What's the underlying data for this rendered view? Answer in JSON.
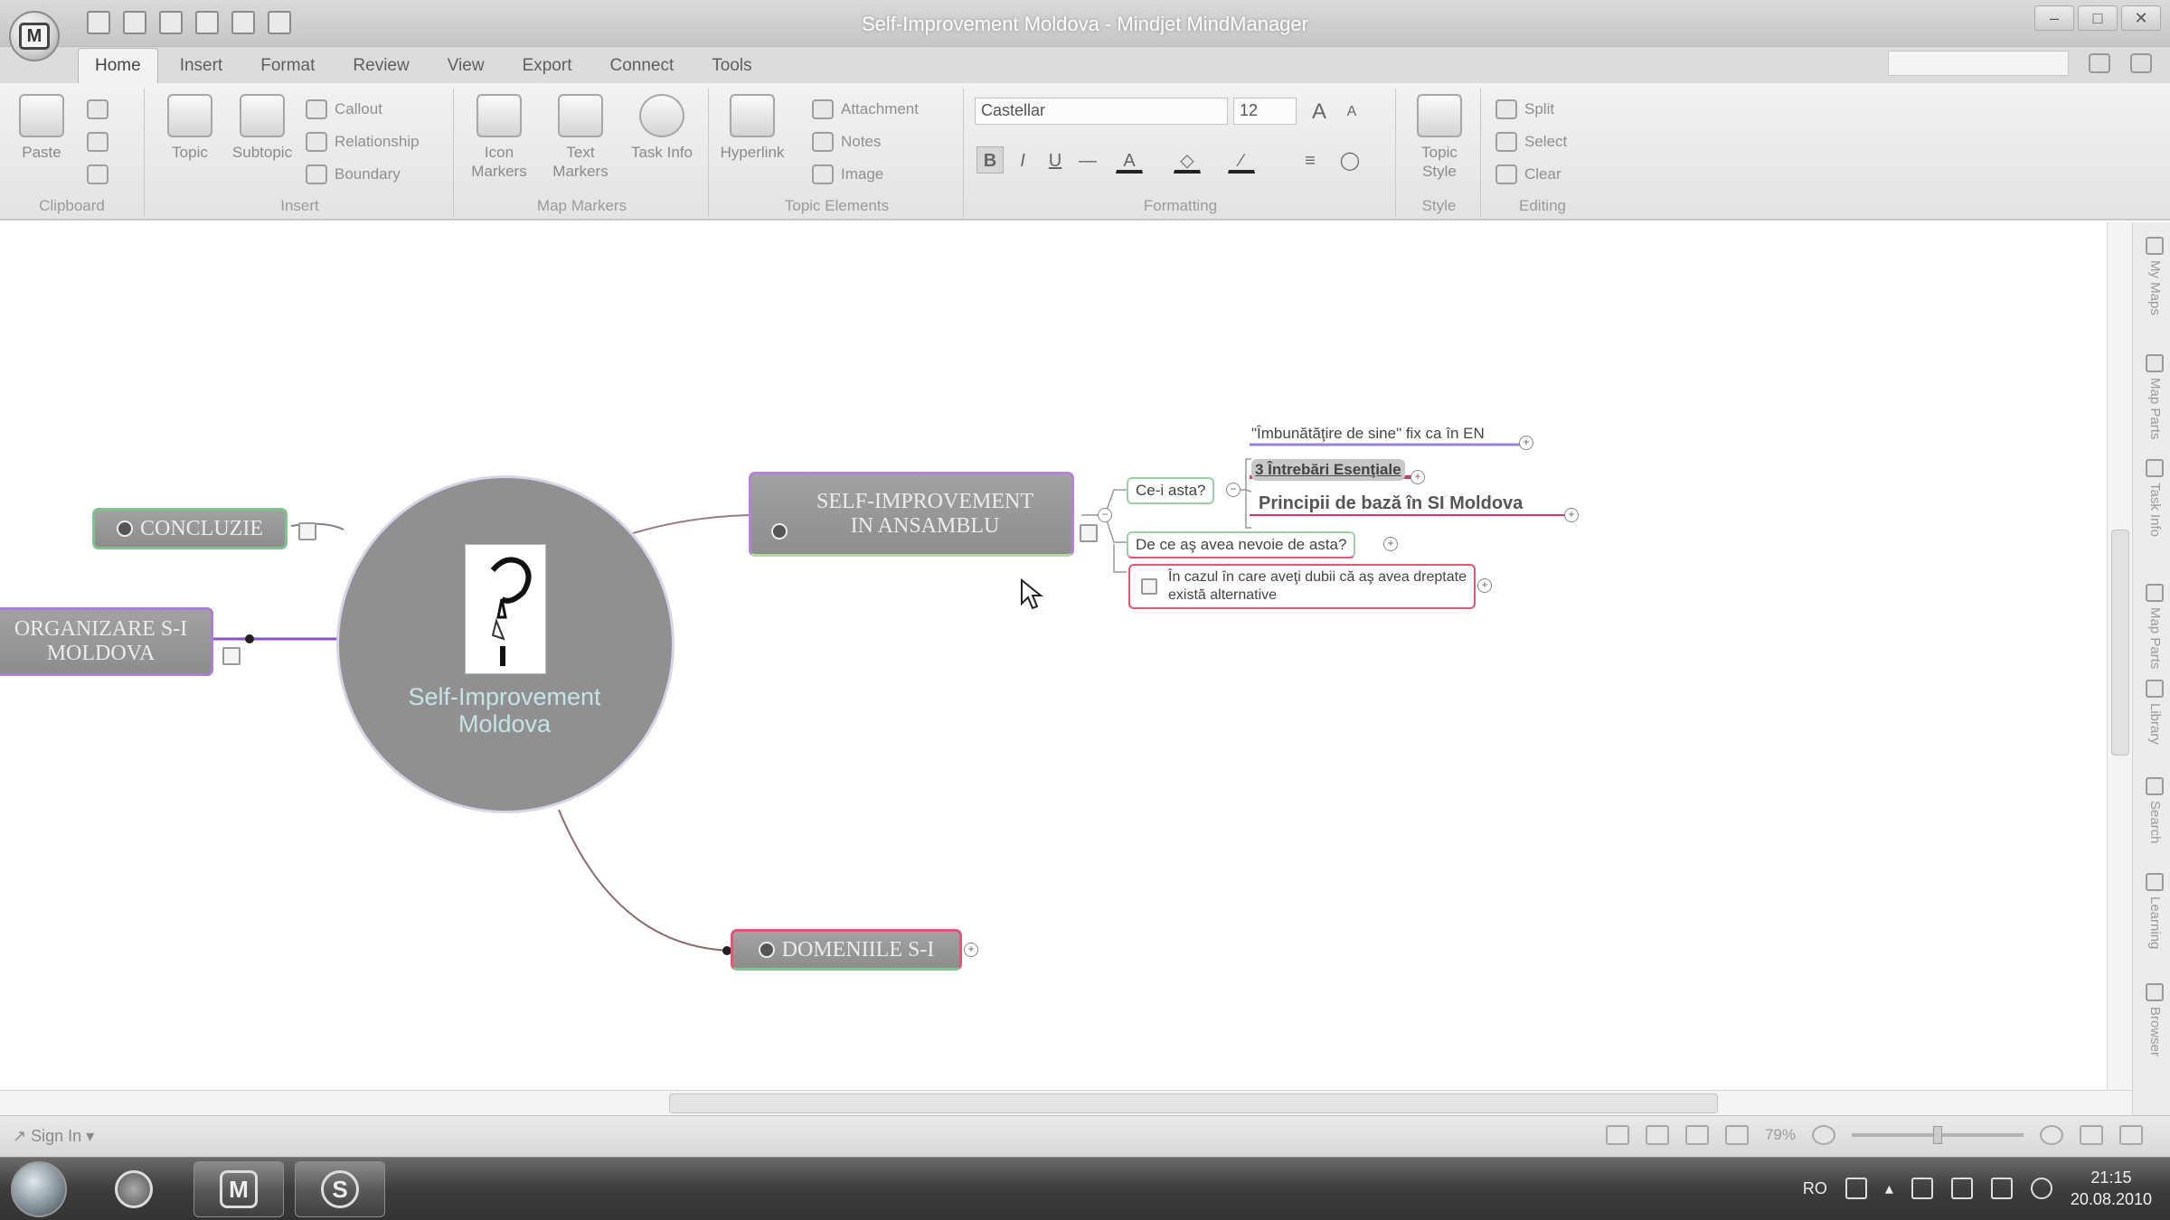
{
  "window": {
    "title": "Self-Improvement Moldova - Mindjet MindManager"
  },
  "app_icon": {
    "letter": "M"
  },
  "tabs": [
    {
      "label": "Home",
      "active": true
    },
    {
      "label": "Insert"
    },
    {
      "label": "Format"
    },
    {
      "label": "Review"
    },
    {
      "label": "View"
    },
    {
      "label": "Export"
    },
    {
      "label": "Connect"
    },
    {
      "label": "Tools"
    }
  ],
  "ribbon": {
    "clipboard": {
      "label": "Clipboard",
      "paste": "Paste"
    },
    "insert": {
      "label": "Insert",
      "topic": "Topic",
      "subtopic": "Subtopic",
      "callout": "Callout",
      "relationship": "Relationship",
      "boundary": "Boundary"
    },
    "map_markers": {
      "label": "Map Markers",
      "icon_markers": "Icon Markers",
      "text_markers": "Text Markers",
      "task_info": "Task Info"
    },
    "topic_elements": {
      "label": "Topic Elements",
      "hyperlink": "Hyperlink",
      "attachment": "Attachment",
      "notes": "Notes",
      "image": "Image"
    },
    "formatting": {
      "label": "Formatting",
      "font": "Castellar",
      "size": "12",
      "grow": "A",
      "shrink": "A",
      "bold": "B",
      "italic": "I",
      "underline": "U"
    },
    "style": {
      "label": "Style",
      "topic_style": "Topic Style"
    },
    "editing": {
      "label": "Editing",
      "split": "Split",
      "select": "Select",
      "clear": "Clear"
    }
  },
  "map": {
    "central": {
      "title": "Self-Improvement Moldova"
    },
    "nodes": {
      "concluzie": "CONCLUZIE",
      "organizare": "ORGANIZARE S-I MOLDOVA",
      "self_improvement": "SELF-IMPROVEMENT IN ANSAMBLU",
      "domeniile": "DOMENIILE S-I"
    },
    "subtopics": {
      "ce_i_asta": "Ce-i asta?",
      "imbunatatire": "\"Îmbunătăţire de sine\" fix ca în EN",
      "intrebari": "3 Întrebări Esenţiale",
      "principii": "Principii de bază în SI Moldova",
      "de_ce": "De ce aş avea nevoie de asta?",
      "in_cazul": "În cazul în care aveţi dubii că aş avea dreptate există alternative"
    }
  },
  "side_panel": [
    "My Maps",
    "Map Parts",
    "Task Info",
    "Map Parts",
    "Library",
    "Search",
    "Learning",
    "Browser"
  ],
  "statusbar": {
    "signin": "Sign In",
    "zoom": "79%"
  },
  "taskbar": {
    "app1": "M",
    "app2": "S",
    "lang": "RO",
    "time": "21:15",
    "date": "20.08.2010"
  },
  "colors": {
    "central_fill": "#909090",
    "node_fill": "#9a9a9a",
    "accent_pink": "#e0306a",
    "accent_purple": "#9a66cc"
  }
}
